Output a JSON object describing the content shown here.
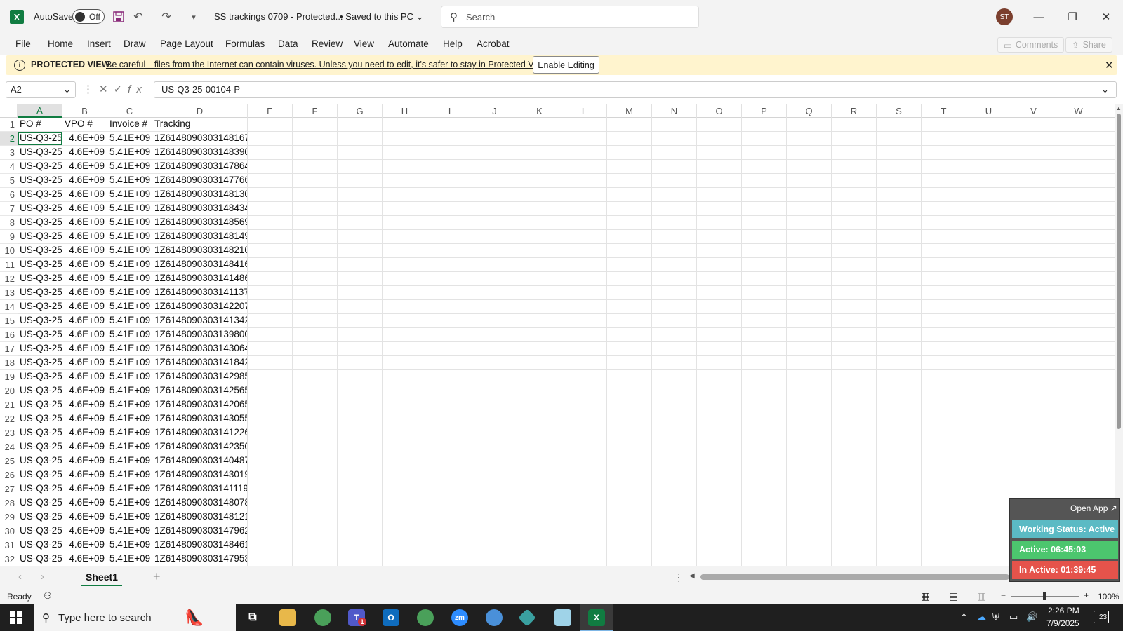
{
  "app": {
    "logo": "X",
    "autosave_label": "AutoSave",
    "autosave_state": "Off",
    "doc_title": "SS trackings 0709  -  Protected...",
    "saved_label": "•  Saved to this PC",
    "search_placeholder": "Search",
    "avatar": "ST"
  },
  "menu": [
    "File",
    "Home",
    "Insert",
    "Draw",
    "Page Layout",
    "Formulas",
    "Data",
    "Review",
    "View",
    "Automate",
    "Help",
    "Acrobat"
  ],
  "ribbon_buttons": {
    "comments": "Comments",
    "share": "Share"
  },
  "protected": {
    "title": "PROTECTED VIEW",
    "message": "Be careful—files from the Internet can contain viruses. Unless you need to edit, it's safer to stay in Protected View.",
    "enable_label": "Enable Editing"
  },
  "formula": {
    "name_box": "A2",
    "fx": "fx",
    "content": "US-Q3-25-00104-P"
  },
  "columns": [
    "A",
    "B",
    "C",
    "D",
    "E",
    "F",
    "G",
    "H",
    "I",
    "J",
    "K",
    "L",
    "M",
    "N",
    "O",
    "P",
    "Q",
    "R",
    "S",
    "T",
    "U",
    "V",
    "W"
  ],
  "header_row": [
    "PO #",
    "VPO #",
    "Invoice #",
    "Tracking"
  ],
  "rows": [
    {
      "n": "2",
      "a": "US-Q3-25-",
      "b": "4.6E+09",
      "c": "5.41E+09",
      "d": "1Z6148090303148167"
    },
    {
      "n": "3",
      "a": "US-Q3-25-",
      "b": "4.6E+09",
      "c": "5.41E+09",
      "d": "1Z6148090303148390"
    },
    {
      "n": "4",
      "a": "US-Q3-25-",
      "b": "4.6E+09",
      "c": "5.41E+09",
      "d": "1Z6148090303147864"
    },
    {
      "n": "5",
      "a": "US-Q3-25-",
      "b": "4.6E+09",
      "c": "5.41E+09",
      "d": "1Z6148090303147766"
    },
    {
      "n": "6",
      "a": "US-Q3-25-",
      "b": "4.6E+09",
      "c": "5.41E+09",
      "d": "1Z6148090303148130"
    },
    {
      "n": "7",
      "a": "US-Q3-25-",
      "b": "4.6E+09",
      "c": "5.41E+09",
      "d": "1Z6148090303148434"
    },
    {
      "n": "8",
      "a": "US-Q3-25-",
      "b": "4.6E+09",
      "c": "5.41E+09",
      "d": "1Z6148090303148569"
    },
    {
      "n": "9",
      "a": "US-Q3-25-",
      "b": "4.6E+09",
      "c": "5.41E+09",
      "d": "1Z6148090303148149"
    },
    {
      "n": "10",
      "a": "US-Q3-25-",
      "b": "4.6E+09",
      "c": "5.41E+09",
      "d": "1Z6148090303148210"
    },
    {
      "n": "11",
      "a": "US-Q3-25-",
      "b": "4.6E+09",
      "c": "5.41E+09",
      "d": "1Z6148090303148416"
    },
    {
      "n": "12",
      "a": "US-Q3-25-",
      "b": "4.6E+09",
      "c": "5.41E+09",
      "d": "1Z6148090303141486"
    },
    {
      "n": "13",
      "a": "US-Q3-25-",
      "b": "4.6E+09",
      "c": "5.41E+09",
      "d": "1Z6148090303141137"
    },
    {
      "n": "14",
      "a": "US-Q3-25-",
      "b": "4.6E+09",
      "c": "5.41E+09",
      "d": "1Z6148090303142207"
    },
    {
      "n": "15",
      "a": "US-Q3-25-",
      "b": "4.6E+09",
      "c": "5.41E+09",
      "d": "1Z6148090303141342"
    },
    {
      "n": "16",
      "a": "US-Q3-25-",
      "b": "4.6E+09",
      "c": "5.41E+09",
      "d": "1Z6148090303139800"
    },
    {
      "n": "17",
      "a": "US-Q3-25-",
      "b": "4.6E+09",
      "c": "5.41E+09",
      "d": "1Z6148090303143064"
    },
    {
      "n": "18",
      "a": "US-Q3-25-",
      "b": "4.6E+09",
      "c": "5.41E+09",
      "d": "1Z6148090303141842"
    },
    {
      "n": "19",
      "a": "US-Q3-25-",
      "b": "4.6E+09",
      "c": "5.41E+09",
      "d": "1Z6148090303142985"
    },
    {
      "n": "20",
      "a": "US-Q3-25-",
      "b": "4.6E+09",
      "c": "5.41E+09",
      "d": "1Z6148090303142565"
    },
    {
      "n": "21",
      "a": "US-Q3-25-",
      "b": "4.6E+09",
      "c": "5.41E+09",
      "d": "1Z6148090303142065"
    },
    {
      "n": "22",
      "a": "US-Q3-25-",
      "b": "4.6E+09",
      "c": "5.41E+09",
      "d": "1Z6148090303143055"
    },
    {
      "n": "23",
      "a": "US-Q3-25-",
      "b": "4.6E+09",
      "c": "5.41E+09",
      "d": "1Z6148090303141226"
    },
    {
      "n": "24",
      "a": "US-Q3-25-",
      "b": "4.6E+09",
      "c": "5.41E+09",
      "d": "1Z6148090303142350"
    },
    {
      "n": "25",
      "a": "US-Q3-25-",
      "b": "4.6E+09",
      "c": "5.41E+09",
      "d": "1Z6148090303140487"
    },
    {
      "n": "26",
      "a": "US-Q3-25-",
      "b": "4.6E+09",
      "c": "5.41E+09",
      "d": "1Z6148090303143019"
    },
    {
      "n": "27",
      "a": "US-Q3-25-",
      "b": "4.6E+09",
      "c": "5.41E+09",
      "d": "1Z6148090303141119"
    },
    {
      "n": "28",
      "a": "US-Q3-25-",
      "b": "4.6E+09",
      "c": "5.41E+09",
      "d": "1Z6148090303148078"
    },
    {
      "n": "29",
      "a": "US-Q3-25-",
      "b": "4.6E+09",
      "c": "5.41E+09",
      "d": "1Z6148090303148121"
    },
    {
      "n": "30",
      "a": "US-Q3-25-",
      "b": "4.6E+09",
      "c": "5.41E+09",
      "d": "1Z6148090303147962"
    },
    {
      "n": "31",
      "a": "US-Q3-25-",
      "b": "4.6E+09",
      "c": "5.41E+09",
      "d": "1Z6148090303148461"
    },
    {
      "n": "32",
      "a": "US-Q3-25-",
      "b": "4.6E+09",
      "c": "5.41E+09",
      "d": "1Z6148090303147953"
    }
  ],
  "sheet": {
    "tab": "Sheet1",
    "add": "+"
  },
  "status": {
    "ready": "Ready",
    "zoom": "100%"
  },
  "widget": {
    "open_app": "Open App ↗",
    "working": "Working Status: Active",
    "active": "Active: 06:45:03",
    "inactive": "In Active: 01:39:45"
  },
  "taskbar": {
    "search_placeholder": "Type here to search",
    "time": "2:26 PM",
    "date": "7/9/2025",
    "notif": "23",
    "teams_badge": "1"
  },
  "colors": {
    "excel_green": "#107c41",
    "protected_bg": "#fff4ce",
    "widget_teal": "#5bbac4",
    "widget_green": "#4cc66e",
    "widget_red": "#e5534b"
  }
}
